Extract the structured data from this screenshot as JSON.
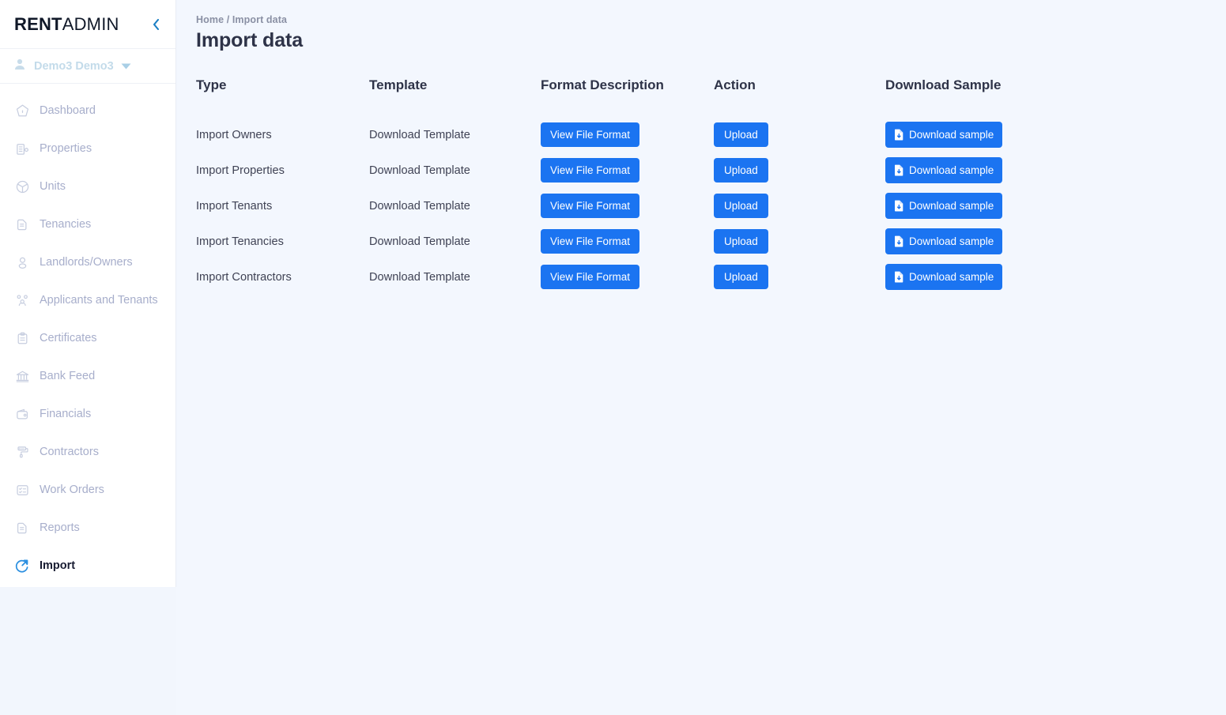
{
  "sidebar": {
    "brand": {
      "bold": "RENT",
      "light": "ADMIN"
    },
    "collapse_icon": "chevron-left-icon",
    "user": {
      "name": "Demo3 Demo3",
      "avatar_icon": "person-icon",
      "caret_icon": "caret-down-icon"
    },
    "items": [
      {
        "label": "Dashboard",
        "icon": "home-pentagon-icon",
        "active": false
      },
      {
        "label": "Properties",
        "icon": "building-icon",
        "active": false
      },
      {
        "label": "Units",
        "icon": "cube-icon",
        "active": false
      },
      {
        "label": "Tenancies",
        "icon": "documents-icon",
        "active": false
      },
      {
        "label": "Landlords/Owners",
        "icon": "user-icon",
        "active": false
      },
      {
        "label": "Applicants and Tenants",
        "icon": "users-group-icon",
        "active": false
      },
      {
        "label": "Certificates",
        "icon": "clipboard-icon",
        "active": false
      },
      {
        "label": "Bank Feed",
        "icon": "bank-icon",
        "active": false
      },
      {
        "label": "Financials",
        "icon": "wallet-icon",
        "active": false
      },
      {
        "label": "Contractors",
        "icon": "paint-roller-icon",
        "active": false
      },
      {
        "label": "Work Orders",
        "icon": "task-list-icon",
        "active": false
      },
      {
        "label": "Reports",
        "icon": "reports-icon",
        "active": false
      },
      {
        "label": "Import",
        "icon": "import-arrow-icon",
        "active": true
      }
    ]
  },
  "header": {
    "breadcrumb": "Home / Import data",
    "title": "Import data"
  },
  "table": {
    "columns": [
      "Type",
      "Template",
      "Format Description",
      "Action",
      "Download Sample"
    ],
    "rows": [
      {
        "type": "Import Owners",
        "template": "Download Template",
        "format_button": "View File Format",
        "action_button": "Upload",
        "sample_button": "Download sample",
        "sample_icon": "file-download-icon"
      },
      {
        "type": "Import Properties",
        "template": "Download Template",
        "format_button": "View File Format",
        "action_button": "Upload",
        "sample_button": "Download sample",
        "sample_icon": "file-download-icon"
      },
      {
        "type": "Import Tenants",
        "template": "Download Template",
        "format_button": "View File Format",
        "action_button": "Upload",
        "sample_button": "Download sample",
        "sample_icon": "file-download-icon"
      },
      {
        "type": "Import Tenancies",
        "template": "Download Template",
        "format_button": "View File Format",
        "action_button": "Upload",
        "sample_button": "Download sample",
        "sample_icon": "file-download-icon"
      },
      {
        "type": "Import Contractors",
        "template": "Download Template",
        "format_button": "View File Format",
        "action_button": "Upload",
        "sample_button": "Download sample",
        "sample_icon": "file-download-icon"
      }
    ]
  },
  "colors": {
    "primary": "#1b74f1",
    "page_bg": "#f3f7fe",
    "sidebar_bg": "#ffffff",
    "muted_text": "#a7aecb",
    "title_text": "#2e3348"
  }
}
